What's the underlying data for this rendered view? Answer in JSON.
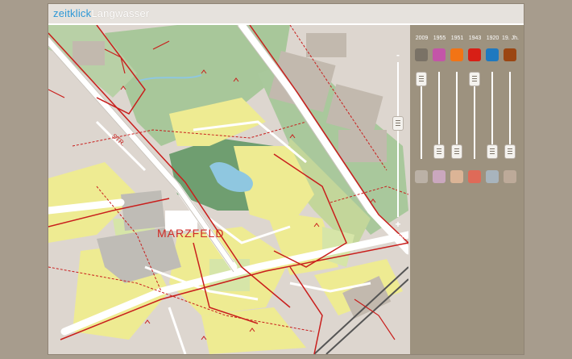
{
  "app": {
    "name_part1": "zeitklick",
    "name_part2": "Langwasser"
  },
  "map": {
    "place_label": "MARZFELD",
    "street_label": "STR."
  },
  "zoom": {
    "minus_label": "-",
    "plus_label": "+",
    "level": "195%",
    "level_fraction": 0.38
  },
  "layers": [
    {
      "label": "2009",
      "color": "#7a7266",
      "faded": "#bbb1a6",
      "level": 0.0
    },
    {
      "label": "1955",
      "color": "#c355a8",
      "faded": "#caa7be",
      "level": 1.0
    },
    {
      "label": "1951",
      "color": "#f27415",
      "faded": "#dbb496",
      "level": 1.0
    },
    {
      "label": "1943",
      "color": "#d81f16",
      "faded": "#df6a58",
      "level": 0.0
    },
    {
      "label": "1920",
      "color": "#1f79c0",
      "faded": "#a8b4bd",
      "level": 1.0
    },
    {
      "label": "19. Jh.",
      "color": "#9b4612",
      "faded": "#bdaa99",
      "level": 1.0
    }
  ]
}
